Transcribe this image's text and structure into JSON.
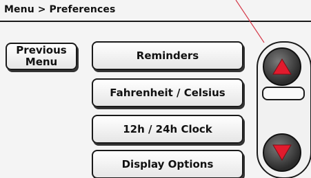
{
  "header": {
    "breadcrumb": "Menu > Preferences"
  },
  "nav": {
    "previous_menu_label": "Previous\nMenu"
  },
  "menu": {
    "items": [
      {
        "label": "Reminders"
      },
      {
        "label": "Fahrenheit / Celsius"
      },
      {
        "label": "12h / 24h Clock"
      },
      {
        "label": "Display Options"
      }
    ]
  },
  "icons": {
    "up": "triangle-up-icon",
    "down": "triangle-down-icon"
  },
  "colors": {
    "arrow_red": "#e21b2d",
    "button_dark": "#2b2b2b",
    "background": "#f4f4f4"
  }
}
